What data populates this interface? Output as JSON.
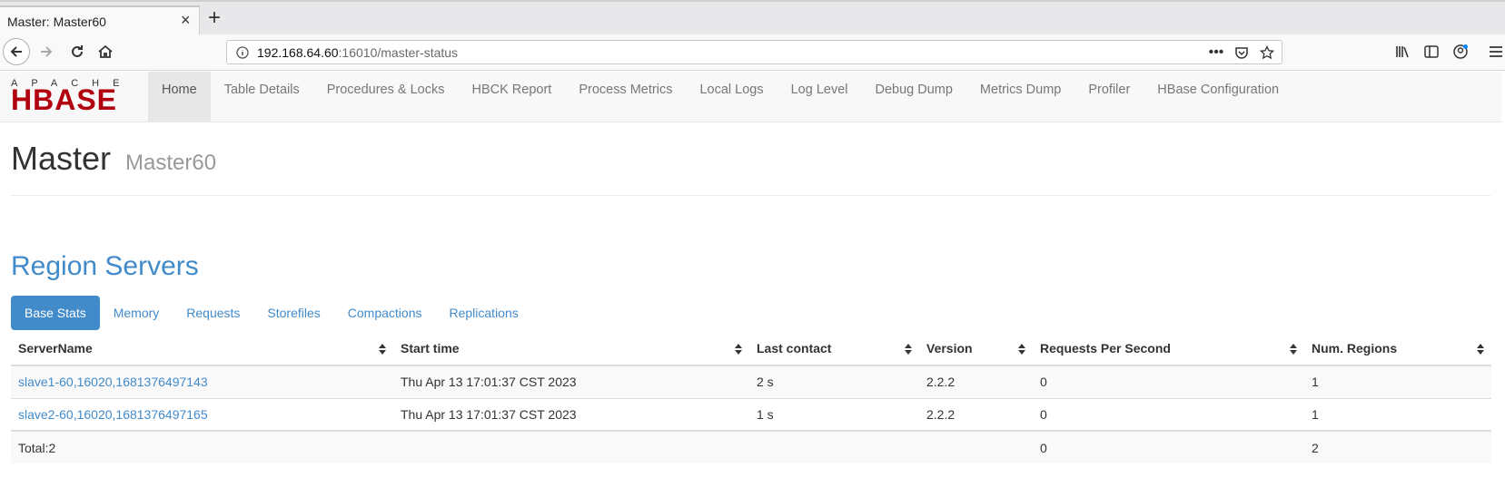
{
  "browser": {
    "tab_title": "Master: Master60",
    "tab_close": "×",
    "new_tab": "+",
    "url_host": "192.168.64.60",
    "url_rest": ":16010/master-status",
    "url_more": "•••"
  },
  "logo": {
    "apache": "APACHE",
    "hbase": "HBASE"
  },
  "topnav": {
    "items": [
      {
        "label": "Home"
      },
      {
        "label": "Table Details"
      },
      {
        "label": "Procedures & Locks"
      },
      {
        "label": "HBCK Report"
      },
      {
        "label": "Process Metrics"
      },
      {
        "label": "Local Logs"
      },
      {
        "label": "Log Level"
      },
      {
        "label": "Debug Dump"
      },
      {
        "label": "Metrics Dump"
      },
      {
        "label": "Profiler"
      },
      {
        "label": "HBase Configuration"
      }
    ]
  },
  "header": {
    "title": "Master",
    "subtitle": "Master60"
  },
  "region_servers": {
    "title": "Region Servers",
    "tabs": [
      {
        "label": "Base Stats"
      },
      {
        "label": "Memory"
      },
      {
        "label": "Requests"
      },
      {
        "label": "Storefiles"
      },
      {
        "label": "Compactions"
      },
      {
        "label": "Replications"
      }
    ],
    "columns": [
      "ServerName",
      "Start time",
      "Last contact",
      "Version",
      "Requests Per Second",
      "Num. Regions"
    ],
    "rows": [
      {
        "server": "slave1-60,16020,1681376497143",
        "start": "Thu Apr 13 17:01:37 CST 2023",
        "contact": "2 s",
        "version": "2.2.2",
        "rps": "0",
        "regions": "1"
      },
      {
        "server": "slave2-60,16020,1681376497165",
        "start": "Thu Apr 13 17:01:37 CST 2023",
        "contact": "1 s",
        "version": "2.2.2",
        "rps": "0",
        "regions": "1"
      }
    ],
    "total": {
      "label": "Total:2",
      "rps": "0",
      "regions": "2"
    }
  },
  "colors": {
    "link": "#428bca",
    "hbase_red": "#b1000e"
  }
}
